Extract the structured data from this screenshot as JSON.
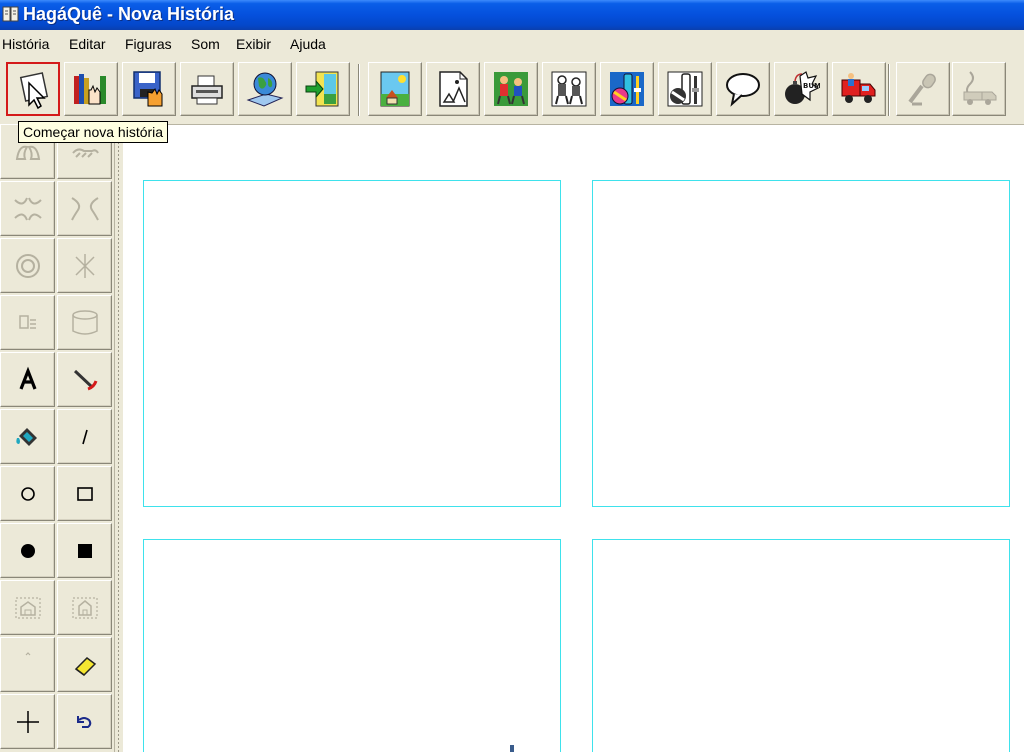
{
  "window": {
    "title": "HagáQuê - Nova História"
  },
  "menu": [
    "História",
    "Editar",
    "Figuras",
    "Som",
    "Exibir",
    "Ajuda"
  ],
  "toolbar": {
    "buttons": [
      {
        "icon": "new-story-hand-pointer-icon"
      },
      {
        "icon": "open-books-icon"
      },
      {
        "icon": "save-floppy-icon"
      },
      {
        "icon": "printer-icon"
      },
      {
        "icon": "globe-book-icon"
      },
      {
        "icon": "exit-door-icon"
      },
      {
        "icon": "scenery-icon"
      },
      {
        "icon": "scenery-document-icon"
      },
      {
        "icon": "characters-icon"
      },
      {
        "icon": "characters-document-icon"
      },
      {
        "icon": "objects-icon"
      },
      {
        "icon": "objects-document-icon"
      },
      {
        "icon": "speech-balloon-icon"
      },
      {
        "icon": "onomatopoeia-bomb-icon"
      },
      {
        "icon": "truck-icon"
      },
      {
        "icon": "microphone-icon"
      },
      {
        "icon": "music-truck-icon"
      }
    ],
    "tooltip": "Começar nova história"
  },
  "palette": {
    "tools": [
      {
        "icon": "flip-horizontal-icon",
        "enabled": false
      },
      {
        "icon": "flip-vertical-icon",
        "enabled": false
      },
      {
        "icon": "shrink-icon",
        "enabled": false
      },
      {
        "icon": "enlarge-icon",
        "enabled": false
      },
      {
        "icon": "rotate-icon",
        "enabled": false
      },
      {
        "icon": "pattern-icon",
        "enabled": false
      },
      {
        "icon": "text-properties-icon",
        "enabled": false
      },
      {
        "icon": "cylinder-icon",
        "enabled": false
      },
      {
        "icon": "text-tool-icon",
        "enabled": true
      },
      {
        "icon": "pen-color-icon",
        "enabled": true
      },
      {
        "icon": "fill-bucket-icon",
        "enabled": true
      },
      {
        "icon": "line-tool-icon",
        "enabled": true
      },
      {
        "icon": "ellipse-outline-icon",
        "enabled": true
      },
      {
        "icon": "rectangle-outline-icon",
        "enabled": true
      },
      {
        "icon": "ellipse-filled-icon",
        "enabled": true
      },
      {
        "icon": "rectangle-filled-icon",
        "enabled": true
      },
      {
        "icon": "bring-front-icon",
        "enabled": false
      },
      {
        "icon": "send-back-icon",
        "enabled": false
      },
      {
        "icon": "small-dot-icon",
        "enabled": false
      },
      {
        "icon": "eraser-icon",
        "enabled": true
      },
      {
        "icon": "crosshair-icon",
        "enabled": true
      },
      {
        "icon": "undo-icon",
        "enabled": true
      }
    ]
  },
  "canvas": {
    "frame_count": 4
  },
  "colors": {
    "titlebar": "#0550dd",
    "frame_border": "#3ee2ec",
    "active_button_border": "#d41a1a",
    "tooltip_bg": "#ffffe1"
  }
}
